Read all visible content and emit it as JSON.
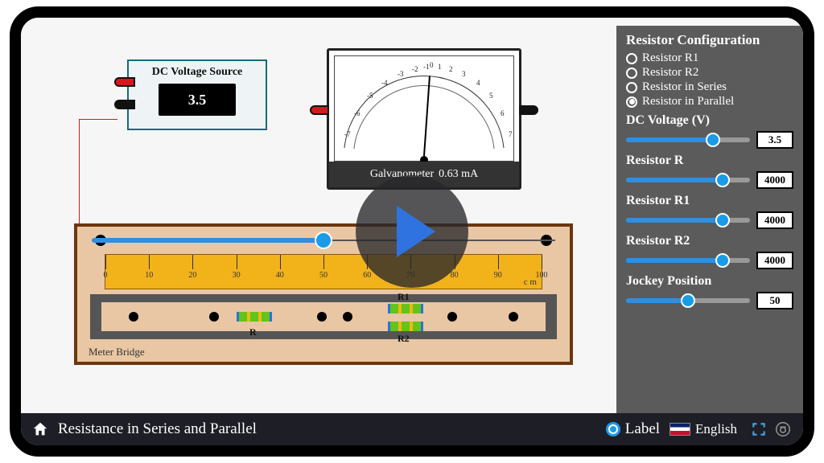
{
  "dc_source": {
    "title": "DC Voltage Source",
    "value": "3.5"
  },
  "galvanometer": {
    "name": "Galvanometer",
    "reading": "0.63 mA",
    "scale_labels": [
      "-7",
      "-6",
      "-5",
      "-4",
      "-3",
      "-2",
      "-1",
      "0",
      "1",
      "2",
      "3",
      "4",
      "5",
      "6",
      "7"
    ]
  },
  "meter_bridge": {
    "caption": "Meter Bridge",
    "unit": "c m",
    "ticks": [
      0,
      10,
      20,
      30,
      40,
      50,
      60,
      70,
      80,
      90,
      100
    ],
    "r_label": "R",
    "r1_label": "R1",
    "r2_label": "R2",
    "jockey_position_pct": 50
  },
  "panel": {
    "config_title": "Resistor Configuration",
    "options": [
      {
        "label": "Resistor R1",
        "checked": false
      },
      {
        "label": "Resistor R2",
        "checked": false
      },
      {
        "label": "Resistor in Series",
        "checked": false
      },
      {
        "label": "Resistor in Parallel",
        "checked": true
      }
    ],
    "controls": {
      "dc_voltage": {
        "label": "DC Voltage (V)",
        "value": "3.5",
        "pct": 70
      },
      "resistor_r": {
        "label": "Resistor R",
        "value": "4000",
        "pct": 78
      },
      "resistor_r1": {
        "label": "Resistor R1",
        "value": "4000",
        "pct": 78
      },
      "resistor_r2": {
        "label": "Resistor R2",
        "value": "4000",
        "pct": 78
      },
      "jockey": {
        "label": "Jockey Position",
        "value": "50",
        "pct": 50
      }
    }
  },
  "footer": {
    "title": "Resistance in Series and Parallel",
    "label_text": "Label",
    "language": "English"
  }
}
